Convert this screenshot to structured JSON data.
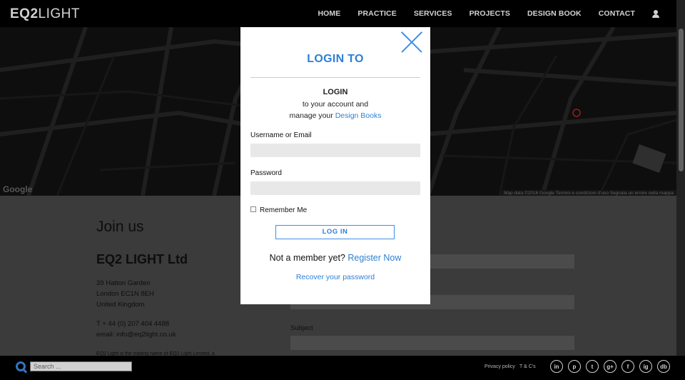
{
  "header": {
    "logo_bold": "EQ2",
    "logo_light": "LIGHT",
    "nav": [
      "HOME",
      "PRACTICE",
      "SERVICES",
      "PROJECTS",
      "DESIGN BOOK",
      "CONTACT"
    ]
  },
  "map": {
    "google_logo": "Google",
    "credits": "Map data ©2016 Google   Termini e condizioni d'uso   Segnala un errore nella mappa"
  },
  "content": {
    "join": "Join us",
    "company": "EQ2 LIGHT Ltd",
    "address": [
      "39 Hatton Garden",
      "London EC1N 8EH",
      "United Kingdom"
    ],
    "phone": "T + 44 (0) 207 404 4488",
    "email": "email: info@eq2light.co.uk",
    "reg": "EQ2 Light is the trading name of EQ2 Light Limited, a",
    "subject_label": "Subject"
  },
  "modal": {
    "title": "LOGIN TO",
    "heading": "LOGIN",
    "desc_line1": "to your account and",
    "desc_line2_prefix": "manage your ",
    "desc_link": "Design Books",
    "username_label": "Username or Email",
    "password_label": "Password",
    "remember_label": "Remember Me",
    "login_button": "LOG IN",
    "member_text": "Not a member yet? ",
    "register_link": "Register Now",
    "recover_link": "Recover your password"
  },
  "footer": {
    "search_placeholder": "Search ...",
    "privacy": "Privacy policy",
    "terms": "T & C's",
    "social": [
      "in",
      "p",
      "t",
      "g+",
      "f",
      "ig",
      "db"
    ]
  },
  "colors": {
    "accent": "#2d7fd6",
    "header_bg": "#000000"
  }
}
